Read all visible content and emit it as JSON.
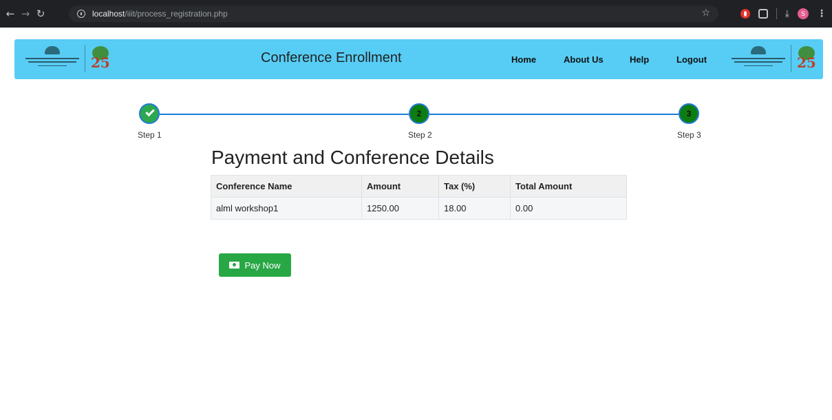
{
  "browser": {
    "url_host": "localhost",
    "url_path": "/iiit/process_registration.php",
    "profile_initial": "S"
  },
  "header": {
    "brand": "Conference Enrollment",
    "nav": {
      "home": "Home",
      "about": "About Us",
      "help": "Help",
      "logout": "Logout"
    },
    "color": "#57cdf5"
  },
  "stepper": {
    "steps": [
      {
        "label": "Step 1",
        "number": "1",
        "status": "completed"
      },
      {
        "label": "Step 2",
        "number": "2",
        "status": "active"
      },
      {
        "label": "Step 3",
        "number": "3",
        "status": "active"
      }
    ],
    "line_color": "#1e7ad6",
    "completed_color": "#2ea84f",
    "active_color": "#0d7d12"
  },
  "main": {
    "title": "Payment and Conference Details",
    "table": {
      "headers": [
        "Conference Name",
        "Amount",
        "Tax (%)",
        "Total Amount"
      ],
      "rows": [
        [
          "alml workshop1",
          "1250.00",
          "18.00",
          "0.00"
        ]
      ]
    },
    "pay_button": {
      "label": "Pay Now",
      "icon": "money-icon",
      "color": "#28a745"
    }
  }
}
